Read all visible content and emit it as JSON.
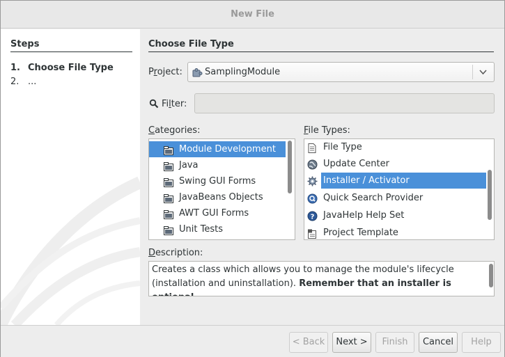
{
  "window": {
    "title": "New File"
  },
  "steps": {
    "heading": "Steps",
    "items": [
      {
        "num": "1.",
        "label": "Choose File Type"
      },
      {
        "num": "2.",
        "label": "..."
      }
    ]
  },
  "main": {
    "title": "Choose File Type",
    "project": {
      "label_pre": "P",
      "label_u": "r",
      "label_post": "oject:",
      "value": "SamplingModule",
      "icon": "module-puzzle-icon"
    },
    "filter": {
      "label_pre": "Fi",
      "label_u": "l",
      "label_post": "ter:",
      "value": "",
      "icon": "search-icon"
    },
    "categories": {
      "label_u": "C",
      "label_post": "ategories:",
      "items": [
        {
          "label": "Module Development",
          "icon": "folder-icon",
          "selected": true
        },
        {
          "label": "Java",
          "icon": "folder-icon"
        },
        {
          "label": "Swing GUI Forms",
          "icon": "folder-icon"
        },
        {
          "label": "JavaBeans Objects",
          "icon": "folder-icon"
        },
        {
          "label": "AWT GUI Forms",
          "icon": "folder-icon"
        },
        {
          "label": "Unit Tests",
          "icon": "folder-icon"
        }
      ]
    },
    "file_types": {
      "label_u": "F",
      "label_post": "ile Types:",
      "items": [
        {
          "label": "File Type",
          "icon": "document-icon"
        },
        {
          "label": "Update Center",
          "icon": "globe-icon"
        },
        {
          "label": "Installer / Activator",
          "icon": "gear-icon",
          "selected": true
        },
        {
          "label": "Quick Search Provider",
          "icon": "search-provider-icon"
        },
        {
          "label": "JavaHelp Help Set",
          "icon": "help-icon"
        },
        {
          "label": "Project Template",
          "icon": "template-icon"
        }
      ]
    },
    "description": {
      "label_u": "D",
      "label_post": "escription:",
      "text_plain": "Creates a class which allows you to manage the module's lifecycle (installation and uninstallation).",
      "text_bold": "Remember that an installer is optional"
    }
  },
  "buttons": {
    "back": "< Back",
    "back_u": "B",
    "next": "Next >",
    "finish": "Finish",
    "cancel": "Cancel",
    "help": "Help"
  },
  "colors": {
    "selection": "#4a90d9",
    "panel": "#ededed"
  }
}
